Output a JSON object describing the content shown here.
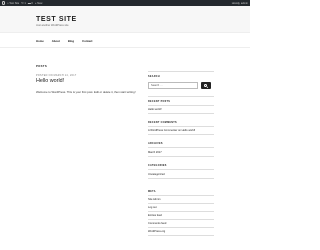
{
  "admin_bar": {
    "items": [
      {
        "label": "Test Site"
      },
      {
        "label": "1"
      },
      {
        "label": "0"
      },
      {
        "label": "New"
      }
    ],
    "greeting": "Howdy, admin"
  },
  "site": {
    "title": "TEST SITE",
    "description": "Just another WordPress site"
  },
  "nav": {
    "items": [
      "Home",
      "About",
      "Blog",
      "Contact"
    ]
  },
  "main": {
    "section_title": "POSTS",
    "post": {
      "date_label": "POSTED ON",
      "date": "MARCH 14, 2017",
      "title": "Hello world!",
      "excerpt": "Welcome to WordPress. This is your first post. Edit or delete it, then start writing!"
    }
  },
  "sidebar": {
    "search": {
      "title": "SEARCH",
      "placeholder": "Search …",
      "button_icon": "search-icon"
    },
    "recent_posts": {
      "title": "RECENT POSTS",
      "items": [
        "Hello world!"
      ]
    },
    "recent_comments": {
      "title": "RECENT COMMENTS",
      "items": [
        "A WordPress Commenter on Hello world!"
      ]
    },
    "archives": {
      "title": "ARCHIVES",
      "items": [
        "March 2017"
      ]
    },
    "categories": {
      "title": "CATEGORIES",
      "items": [
        "Uncategorized"
      ]
    },
    "meta": {
      "title": "META",
      "items": [
        "Site Admin",
        "Log out",
        "Entries feed",
        "Comments feed",
        "WordPress.org"
      ]
    }
  }
}
